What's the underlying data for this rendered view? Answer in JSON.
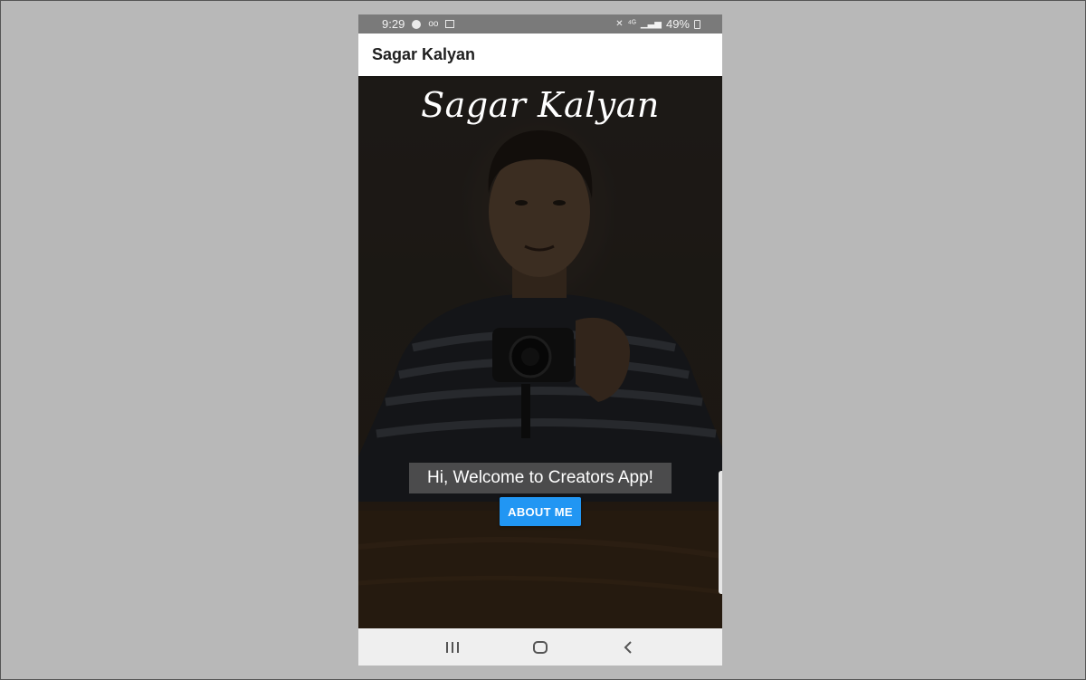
{
  "status_bar": {
    "time": "9:29",
    "battery": "49%",
    "icons": [
      "navigation-icon",
      "voicemail-icon",
      "message-icon",
      "mute-icon",
      "wifi-icon",
      "signal-icon",
      "battery-icon"
    ]
  },
  "app_bar": {
    "title": "Sagar Kalyan"
  },
  "hero": {
    "name": "Sagar Kalyan",
    "welcome_text": "Hi, Welcome to Creators App!",
    "about_button_label": "ABOUT ME"
  },
  "colors": {
    "button": "#2196f3",
    "app_bar": "#ffffff",
    "status_bar": "#7a7a7a",
    "nav_bar": "#efefef",
    "background": "#b8b8b8"
  },
  "nav_bar": {
    "icons": [
      "recent-apps-icon",
      "home-icon",
      "back-icon"
    ]
  }
}
